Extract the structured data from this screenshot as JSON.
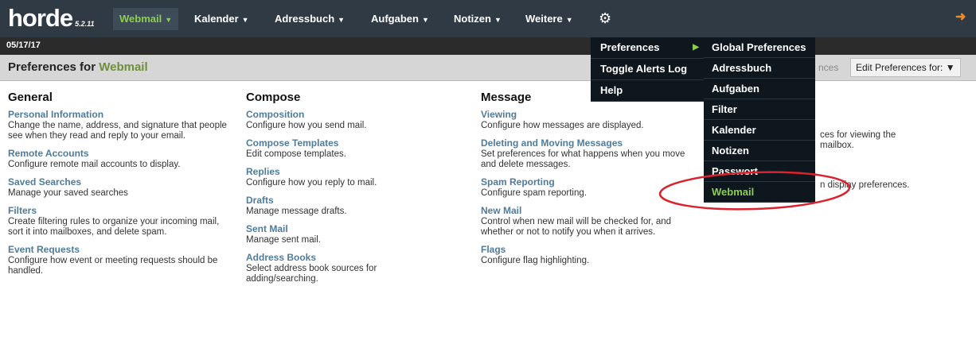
{
  "brand": {
    "logo": "horde",
    "version": "5.2.11"
  },
  "nav": [
    {
      "label": "Webmail"
    },
    {
      "label": "Kalender"
    },
    {
      "label": "Adressbuch"
    },
    {
      "label": "Aufgaben"
    },
    {
      "label": "Notizen"
    },
    {
      "label": "Weitere"
    }
  ],
  "date": "05/17/17",
  "page": {
    "title_prefix": "Preferences for",
    "title_app": "Webmail",
    "prefs_link": "nces",
    "edit_for_label": "Edit Preferences for:"
  },
  "menu1": [
    {
      "label": "Preferences"
    },
    {
      "label": "Toggle Alerts Log"
    },
    {
      "label": "Help"
    }
  ],
  "menu2": [
    {
      "label": "Global Preferences"
    },
    {
      "label": "Adressbuch"
    },
    {
      "label": "Aufgaben"
    },
    {
      "label": "Filter"
    },
    {
      "label": "Kalender"
    },
    {
      "label": "Notizen"
    },
    {
      "label": "Passwort"
    },
    {
      "label": "Webmail"
    }
  ],
  "columns": {
    "general": {
      "title": "General",
      "items": [
        {
          "link": "Personal Information",
          "desc": "Change the name, address, and signature that people see when they read and reply to your email."
        },
        {
          "link": "Remote Accounts",
          "desc": "Configure remote mail accounts to display."
        },
        {
          "link": "Saved Searches",
          "desc": "Manage your saved searches"
        },
        {
          "link": "Filters",
          "desc": "Create filtering rules to organize your incoming mail, sort it into mailboxes, and delete spam."
        },
        {
          "link": "Event Requests",
          "desc": "Configure how event or meeting requests should be handled."
        }
      ]
    },
    "compose": {
      "title": "Compose",
      "items": [
        {
          "link": "Composition",
          "desc": "Configure how you send mail."
        },
        {
          "link": "Compose Templates",
          "desc": "Edit compose templates."
        },
        {
          "link": "Replies",
          "desc": "Configure how you reply to mail."
        },
        {
          "link": "Drafts",
          "desc": "Manage message drafts."
        },
        {
          "link": "Sent Mail",
          "desc": "Manage sent mail."
        },
        {
          "link": "Address Books",
          "desc": "Select address book sources for adding/searching."
        }
      ]
    },
    "message": {
      "title": "Message",
      "items": [
        {
          "link": "Viewing",
          "desc": "Configure how messages are displayed."
        },
        {
          "link": "Deleting and Moving Messages",
          "desc": "Set preferences for what happens when you move and delete messages."
        },
        {
          "link": "Spam Reporting",
          "desc": "Configure spam reporting."
        },
        {
          "link": "New Mail",
          "desc": "Control when new mail will be checked for, and whether or not to notify you when it arrives."
        },
        {
          "link": "Flags",
          "desc": "Configure flag highlighting."
        }
      ]
    },
    "fourth": {
      "line1": "ces for viewing the",
      "line2": "mailbox.",
      "line3": "n display preferences."
    }
  }
}
